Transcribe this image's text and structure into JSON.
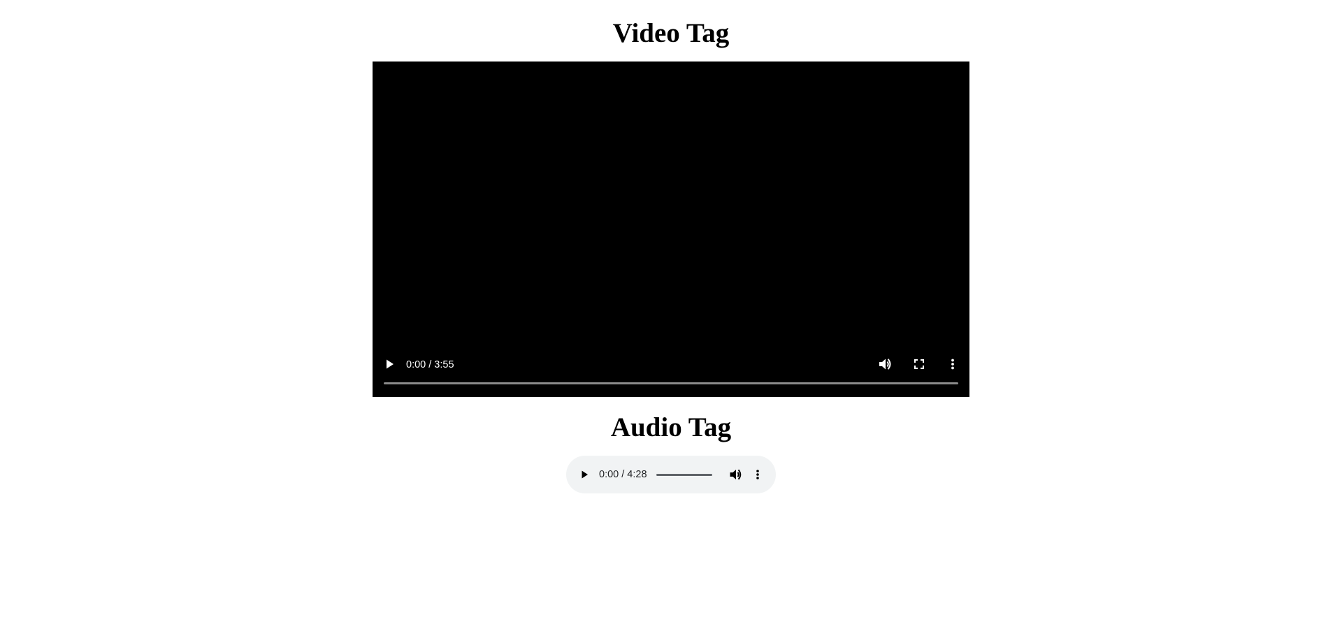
{
  "video_section": {
    "heading": "Video Tag",
    "player": {
      "current_time": "0:00",
      "duration": "3:55",
      "time_display": "0:00 / 3:55",
      "progress_fraction": 0,
      "controls": [
        "play-icon",
        "volume-icon",
        "fullscreen-icon",
        "more-options-icon"
      ]
    }
  },
  "audio_section": {
    "heading": "Audio Tag",
    "player": {
      "current_time": "0:00",
      "duration": "4:28",
      "time_display": "0:00 / 4:28",
      "progress_fraction": 0,
      "controls": [
        "play-icon",
        "volume-icon",
        "more-options-icon"
      ]
    }
  },
  "colors": {
    "video_background": "#000000",
    "video_controls_fg": "#ffffff",
    "audio_background": "#f1f3f4",
    "audio_controls_fg": "#202124"
  }
}
